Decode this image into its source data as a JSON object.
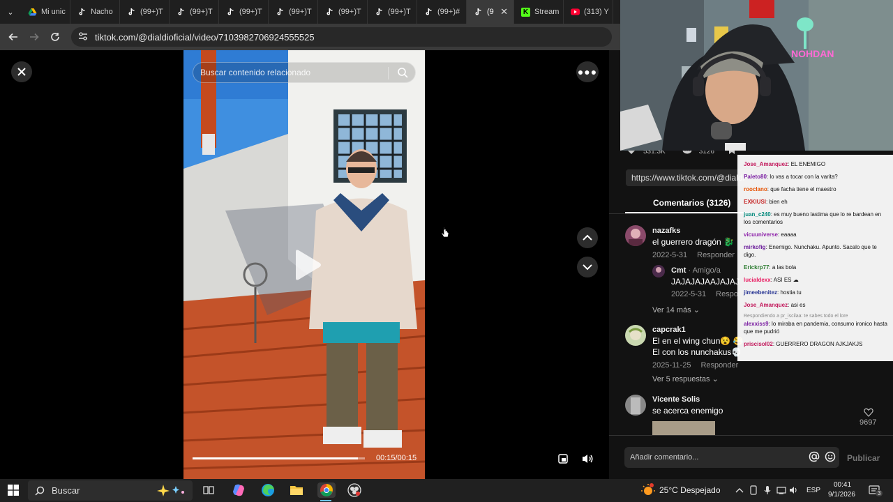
{
  "browser": {
    "tabs": [
      {
        "label": "Mi unic",
        "icon": "drive-icon",
        "color": "#f4b400"
      },
      {
        "label": "Nacho",
        "icon": "tiktok-icon"
      },
      {
        "label": "(99+)T",
        "icon": "tiktok-icon"
      },
      {
        "label": "(99+)T",
        "icon": "tiktok-icon"
      },
      {
        "label": "(99+)T",
        "icon": "tiktok-icon"
      },
      {
        "label": "(99+)T",
        "icon": "tiktok-icon"
      },
      {
        "label": "(99+)T",
        "icon": "tiktok-icon"
      },
      {
        "label": "(99+)T",
        "icon": "tiktok-icon"
      },
      {
        "label": "(99+)#",
        "icon": "tiktok-icon"
      },
      {
        "label": "(9",
        "icon": "tiktok-icon",
        "active": true
      },
      {
        "label": "Stream",
        "icon": "kick-icon",
        "color": "#53fc18"
      },
      {
        "label": "(313) Y",
        "icon": "youtube-icon",
        "color": "#ff0033"
      }
    ],
    "url": "tiktok.com/@dialdioficial/video/7103982706924555525"
  },
  "video": {
    "search_placeholder": "Buscar contenido relacionado",
    "time": "00:15/00:15",
    "progress": 0.96
  },
  "panel": {
    "likes": "531.3K",
    "comments_count": "3126",
    "share_link": "https://www.tiktok.com/@dialdi",
    "comments_tab": "Comentarios (3126)",
    "comments": [
      {
        "user": "nazafks",
        "text": "el guerrero dragón 🐉",
        "date": "2022-5-31",
        "reply": "Responder",
        "sub": {
          "user": "Cmt",
          "tag": "· Amigo/a",
          "text": "JAJAJAJAAJAJAJ",
          "date": "2022-5-31",
          "reply": "Respo"
        },
        "more": "Ver 14 más"
      },
      {
        "user": "capcrak1",
        "text": "El en el wing chun😵 😂",
        "text2": "El con los nunchakus💀",
        "date": "2025-11-25",
        "reply": "Responder",
        "more": "Ver 5 respuestas"
      },
      {
        "user": "Vicente Solis",
        "text": "se acerca enemigo",
        "likes": "9697"
      }
    ],
    "composer_placeholder": "Añadir comentario...",
    "publish": "Publicar"
  },
  "chat": {
    "lines": [
      {
        "user": "Jose_Amanquez",
        "color": "#c2185b",
        "msg": "EL ENEMIGO"
      },
      {
        "user": "Paleto80",
        "color": "#7b1fa2",
        "msg": "lo vas a tocar con la varita?"
      },
      {
        "user": "rooclano",
        "color": "#e65100",
        "msg": "que facha tiene el maestro"
      },
      {
        "user": "EXKIUSI",
        "color": "#c62828",
        "msg": "bien eh"
      },
      {
        "user": "juan_c240",
        "color": "#00897b",
        "msg": "es muy bueno lastima que lo re bardean en los comentarios"
      },
      {
        "user": "vicuuniverse",
        "color": "#8e24aa",
        "msg": "eaaaa"
      },
      {
        "user": "mirkofig",
        "color": "#6a1b9a",
        "msg": "Enemigo. Nunchaku. Apunto. Sacalo que te digo."
      },
      {
        "user": "Erickrp77",
        "color": "#2e7d32",
        "msg": "a las bola"
      },
      {
        "user": "lucialdexx",
        "color": "#e91e63",
        "msg": "ASI ES ☁"
      },
      {
        "user": "jimeebenitez",
        "color": "#283593",
        "msg": "hostia tu"
      },
      {
        "user": "Jose_Amanquez",
        "color": "#c2185b",
        "msg": "asi es"
      },
      {
        "note": "Respondiendo a pr_iscilaa: te sabes todo el lore"
      },
      {
        "user": "alexxiss9",
        "color": "#7b1fa2",
        "msg": "lo miraba en pandemia, consumo ironico hasta que me pudrió"
      },
      {
        "user": "priscisol02",
        "color": "#c2185b",
        "msg": "GUERRERO DRAGON AJKJAKJS"
      }
    ]
  },
  "webcam": {
    "neon_text": "NOHDAN"
  },
  "taskbar": {
    "search": "Buscar",
    "weather": "25°C  Despejado",
    "lang": "ESP",
    "time": "00:41",
    "date": "9/1/2026",
    "notifications": "3"
  }
}
